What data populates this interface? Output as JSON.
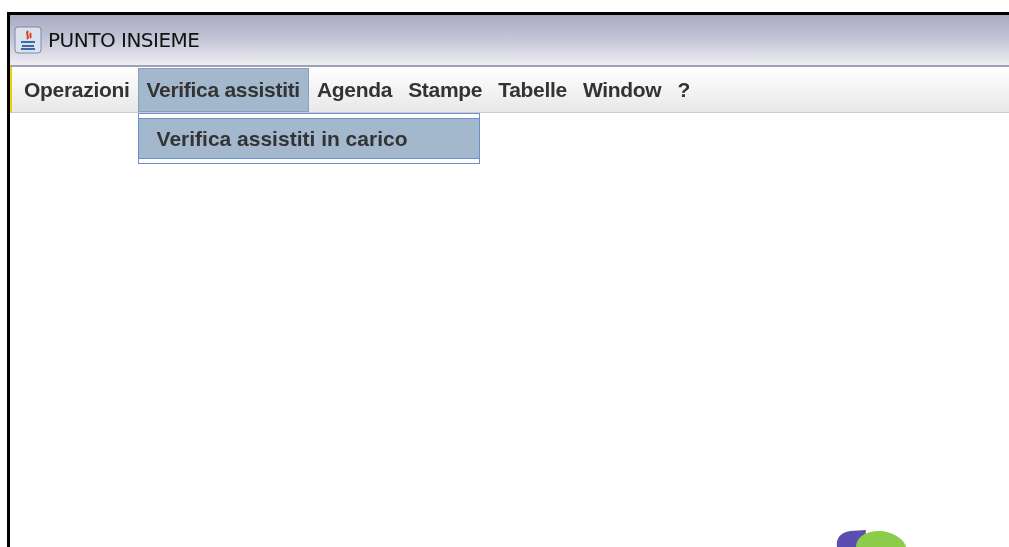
{
  "window": {
    "title": "PUNTO INSIEME"
  },
  "menu": [
    {
      "label": "Operazioni",
      "selected": false
    },
    {
      "label": "Verifica assistiti",
      "selected": true
    },
    {
      "label": "Agenda",
      "selected": false
    },
    {
      "label": "Stampe",
      "selected": false
    },
    {
      "label": "Tabelle",
      "selected": false
    },
    {
      "label": "Window",
      "selected": false
    },
    {
      "label": "?",
      "selected": false
    }
  ],
  "dropdown": {
    "items": [
      {
        "label": "Verifica assistiti in carico",
        "selected": true
      }
    ]
  }
}
